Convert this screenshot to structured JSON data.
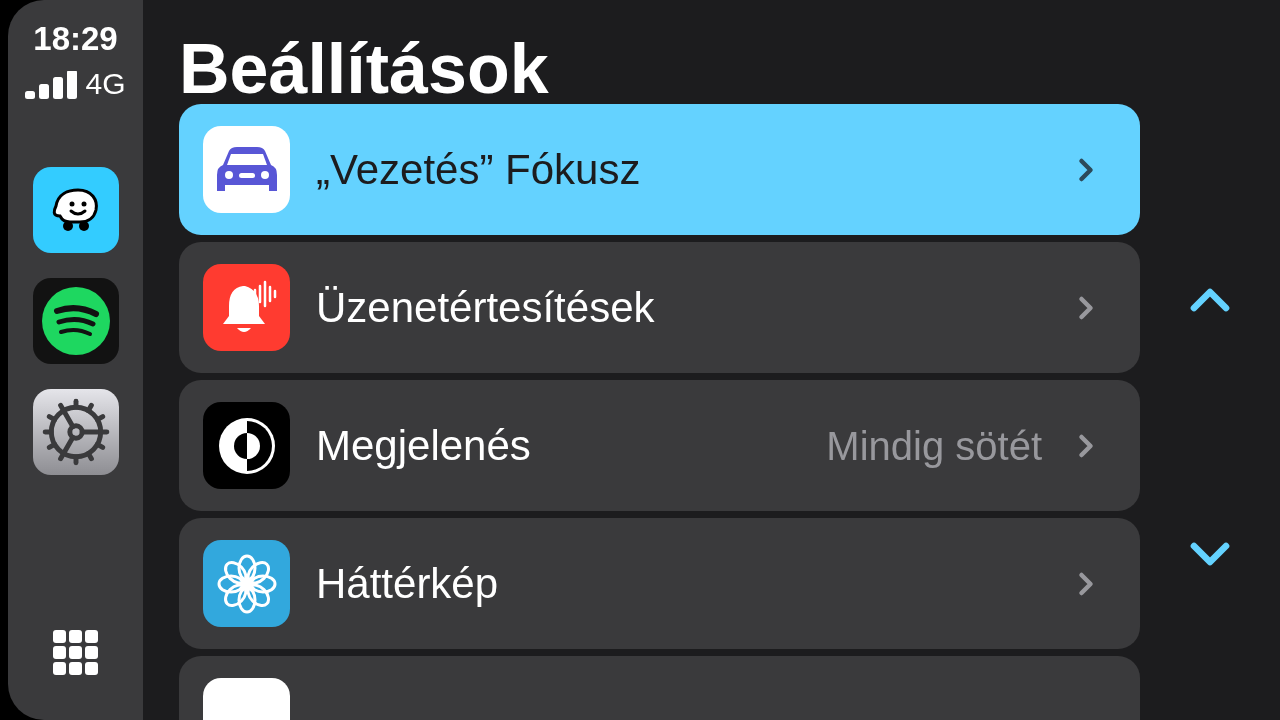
{
  "status": {
    "time": "18:29",
    "network": "4G"
  },
  "dock": [
    {
      "kind": "waze"
    },
    {
      "kind": "spotify"
    },
    {
      "kind": "settings"
    }
  ],
  "title": "Beállítások",
  "rows": [
    {
      "kind": "focus",
      "label": "„Vezetés” Fókusz",
      "selected": true
    },
    {
      "kind": "notify",
      "label": "Üzenetértesítések",
      "selected": false
    },
    {
      "kind": "appearance",
      "label": "Megjelenés",
      "value": "Mindig sötét",
      "selected": false
    },
    {
      "kind": "wallpaper",
      "label": "Háttérkép",
      "selected": false
    }
  ]
}
